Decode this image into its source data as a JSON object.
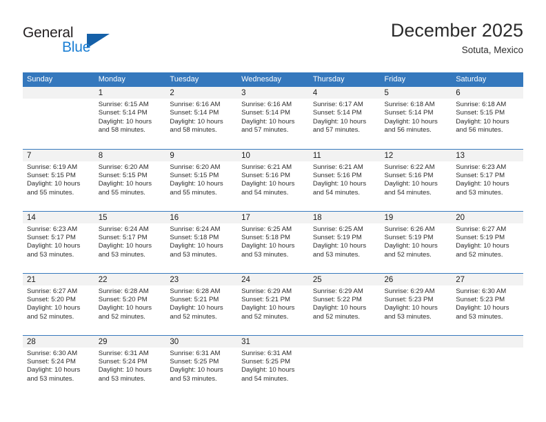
{
  "brand": {
    "name_primary": "General",
    "name_secondary": "Blue",
    "logo_icon": "triangle-logo-icon"
  },
  "header": {
    "title": "December 2025",
    "location": "Sotuta, Mexico"
  },
  "colors": {
    "header_blue": "#3578bd",
    "brand_blue": "#1b7fd4",
    "logo_blue": "#1560a8",
    "daynum_background": "#f2f2f2",
    "text": "#2b2b2b"
  },
  "weekday_headers": [
    "Sunday",
    "Monday",
    "Tuesday",
    "Wednesday",
    "Thursday",
    "Friday",
    "Saturday"
  ],
  "weeks": [
    [
      {
        "day": "",
        "sunrise": "",
        "sunset": "",
        "daylight_line1": "",
        "daylight_line2": ""
      },
      {
        "day": "1",
        "sunrise": "Sunrise: 6:15 AM",
        "sunset": "Sunset: 5:14 PM",
        "daylight_line1": "Daylight: 10 hours",
        "daylight_line2": "and 58 minutes."
      },
      {
        "day": "2",
        "sunrise": "Sunrise: 6:16 AM",
        "sunset": "Sunset: 5:14 PM",
        "daylight_line1": "Daylight: 10 hours",
        "daylight_line2": "and 58 minutes."
      },
      {
        "day": "3",
        "sunrise": "Sunrise: 6:16 AM",
        "sunset": "Sunset: 5:14 PM",
        "daylight_line1": "Daylight: 10 hours",
        "daylight_line2": "and 57 minutes."
      },
      {
        "day": "4",
        "sunrise": "Sunrise: 6:17 AM",
        "sunset": "Sunset: 5:14 PM",
        "daylight_line1": "Daylight: 10 hours",
        "daylight_line2": "and 57 minutes."
      },
      {
        "day": "5",
        "sunrise": "Sunrise: 6:18 AM",
        "sunset": "Sunset: 5:14 PM",
        "daylight_line1": "Daylight: 10 hours",
        "daylight_line2": "and 56 minutes."
      },
      {
        "day": "6",
        "sunrise": "Sunrise: 6:18 AM",
        "sunset": "Sunset: 5:15 PM",
        "daylight_line1": "Daylight: 10 hours",
        "daylight_line2": "and 56 minutes."
      }
    ],
    [
      {
        "day": "7",
        "sunrise": "Sunrise: 6:19 AM",
        "sunset": "Sunset: 5:15 PM",
        "daylight_line1": "Daylight: 10 hours",
        "daylight_line2": "and 55 minutes."
      },
      {
        "day": "8",
        "sunrise": "Sunrise: 6:20 AM",
        "sunset": "Sunset: 5:15 PM",
        "daylight_line1": "Daylight: 10 hours",
        "daylight_line2": "and 55 minutes."
      },
      {
        "day": "9",
        "sunrise": "Sunrise: 6:20 AM",
        "sunset": "Sunset: 5:15 PM",
        "daylight_line1": "Daylight: 10 hours",
        "daylight_line2": "and 55 minutes."
      },
      {
        "day": "10",
        "sunrise": "Sunrise: 6:21 AM",
        "sunset": "Sunset: 5:16 PM",
        "daylight_line1": "Daylight: 10 hours",
        "daylight_line2": "and 54 minutes."
      },
      {
        "day": "11",
        "sunrise": "Sunrise: 6:21 AM",
        "sunset": "Sunset: 5:16 PM",
        "daylight_line1": "Daylight: 10 hours",
        "daylight_line2": "and 54 minutes."
      },
      {
        "day": "12",
        "sunrise": "Sunrise: 6:22 AM",
        "sunset": "Sunset: 5:16 PM",
        "daylight_line1": "Daylight: 10 hours",
        "daylight_line2": "and 54 minutes."
      },
      {
        "day": "13",
        "sunrise": "Sunrise: 6:23 AM",
        "sunset": "Sunset: 5:17 PM",
        "daylight_line1": "Daylight: 10 hours",
        "daylight_line2": "and 53 minutes."
      }
    ],
    [
      {
        "day": "14",
        "sunrise": "Sunrise: 6:23 AM",
        "sunset": "Sunset: 5:17 PM",
        "daylight_line1": "Daylight: 10 hours",
        "daylight_line2": "and 53 minutes."
      },
      {
        "day": "15",
        "sunrise": "Sunrise: 6:24 AM",
        "sunset": "Sunset: 5:17 PM",
        "daylight_line1": "Daylight: 10 hours",
        "daylight_line2": "and 53 minutes."
      },
      {
        "day": "16",
        "sunrise": "Sunrise: 6:24 AM",
        "sunset": "Sunset: 5:18 PM",
        "daylight_line1": "Daylight: 10 hours",
        "daylight_line2": "and 53 minutes."
      },
      {
        "day": "17",
        "sunrise": "Sunrise: 6:25 AM",
        "sunset": "Sunset: 5:18 PM",
        "daylight_line1": "Daylight: 10 hours",
        "daylight_line2": "and 53 minutes."
      },
      {
        "day": "18",
        "sunrise": "Sunrise: 6:25 AM",
        "sunset": "Sunset: 5:19 PM",
        "daylight_line1": "Daylight: 10 hours",
        "daylight_line2": "and 53 minutes."
      },
      {
        "day": "19",
        "sunrise": "Sunrise: 6:26 AM",
        "sunset": "Sunset: 5:19 PM",
        "daylight_line1": "Daylight: 10 hours",
        "daylight_line2": "and 52 minutes."
      },
      {
        "day": "20",
        "sunrise": "Sunrise: 6:27 AM",
        "sunset": "Sunset: 5:19 PM",
        "daylight_line1": "Daylight: 10 hours",
        "daylight_line2": "and 52 minutes."
      }
    ],
    [
      {
        "day": "21",
        "sunrise": "Sunrise: 6:27 AM",
        "sunset": "Sunset: 5:20 PM",
        "daylight_line1": "Daylight: 10 hours",
        "daylight_line2": "and 52 minutes."
      },
      {
        "day": "22",
        "sunrise": "Sunrise: 6:28 AM",
        "sunset": "Sunset: 5:20 PM",
        "daylight_line1": "Daylight: 10 hours",
        "daylight_line2": "and 52 minutes."
      },
      {
        "day": "23",
        "sunrise": "Sunrise: 6:28 AM",
        "sunset": "Sunset: 5:21 PM",
        "daylight_line1": "Daylight: 10 hours",
        "daylight_line2": "and 52 minutes."
      },
      {
        "day": "24",
        "sunrise": "Sunrise: 6:29 AM",
        "sunset": "Sunset: 5:21 PM",
        "daylight_line1": "Daylight: 10 hours",
        "daylight_line2": "and 52 minutes."
      },
      {
        "day": "25",
        "sunrise": "Sunrise: 6:29 AM",
        "sunset": "Sunset: 5:22 PM",
        "daylight_line1": "Daylight: 10 hours",
        "daylight_line2": "and 52 minutes."
      },
      {
        "day": "26",
        "sunrise": "Sunrise: 6:29 AM",
        "sunset": "Sunset: 5:23 PM",
        "daylight_line1": "Daylight: 10 hours",
        "daylight_line2": "and 53 minutes."
      },
      {
        "day": "27",
        "sunrise": "Sunrise: 6:30 AM",
        "sunset": "Sunset: 5:23 PM",
        "daylight_line1": "Daylight: 10 hours",
        "daylight_line2": "and 53 minutes."
      }
    ],
    [
      {
        "day": "28",
        "sunrise": "Sunrise: 6:30 AM",
        "sunset": "Sunset: 5:24 PM",
        "daylight_line1": "Daylight: 10 hours",
        "daylight_line2": "and 53 minutes."
      },
      {
        "day": "29",
        "sunrise": "Sunrise: 6:31 AM",
        "sunset": "Sunset: 5:24 PM",
        "daylight_line1": "Daylight: 10 hours",
        "daylight_line2": "and 53 minutes."
      },
      {
        "day": "30",
        "sunrise": "Sunrise: 6:31 AM",
        "sunset": "Sunset: 5:25 PM",
        "daylight_line1": "Daylight: 10 hours",
        "daylight_line2": "and 53 minutes."
      },
      {
        "day": "31",
        "sunrise": "Sunrise: 6:31 AM",
        "sunset": "Sunset: 5:25 PM",
        "daylight_line1": "Daylight: 10 hours",
        "daylight_line2": "and 54 minutes."
      },
      {
        "day": "",
        "sunrise": "",
        "sunset": "",
        "daylight_line1": "",
        "daylight_line2": ""
      },
      {
        "day": "",
        "sunrise": "",
        "sunset": "",
        "daylight_line1": "",
        "daylight_line2": ""
      },
      {
        "day": "",
        "sunrise": "",
        "sunset": "",
        "daylight_line1": "",
        "daylight_line2": ""
      }
    ]
  ]
}
